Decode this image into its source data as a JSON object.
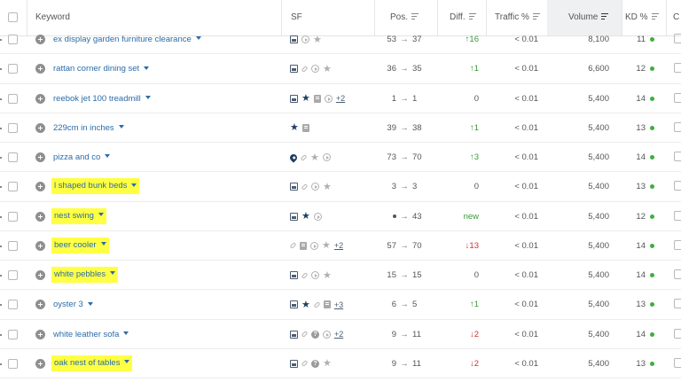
{
  "header": {
    "keyword": "Keyword",
    "sf": "SF",
    "pos": "Pos.",
    "diff": "Diff.",
    "traffic": "Traffic %",
    "volume": "Volume",
    "kd": "KD %",
    "next": "C"
  },
  "colors": {
    "highlight": "#ffff44",
    "link": "#2b6ca8",
    "up": "#3a9a3a",
    "down": "#d0312d",
    "kd_dot": "#3fae3f"
  },
  "rows": [
    {
      "keyword": "ex display garden furniture clearance",
      "highlight": false,
      "sf": [
        "serp-feature-icon",
        "video-icon",
        "star-icon"
      ],
      "more": "",
      "pos_from": "53",
      "pos_to": "37",
      "diff_dir": "up",
      "diff": "16",
      "traffic": "< 0.01",
      "volume": "8,100",
      "kd": "11"
    },
    {
      "keyword": "rattan corner dining set",
      "highlight": false,
      "sf": [
        "serp-feature-icon",
        "link-icon",
        "video-icon",
        "star-icon"
      ],
      "more": "",
      "pos_from": "36",
      "pos_to": "35",
      "diff_dir": "up",
      "diff": "1",
      "traffic": "< 0.01",
      "volume": "6,600",
      "kd": "12"
    },
    {
      "keyword": "reebok jet 100 treadmill",
      "highlight": false,
      "sf": [
        "serp-feature-icon",
        "star-filled-icon",
        "review-icon",
        "video-icon"
      ],
      "more": "+2",
      "pos_from": "1",
      "pos_to": "1",
      "diff_dir": "zero",
      "diff": "0",
      "traffic": "< 0.01",
      "volume": "5,400",
      "kd": "14"
    },
    {
      "keyword": "229cm in inches",
      "highlight": false,
      "sf": [
        "star-filled-icon",
        "review-icon"
      ],
      "more": "",
      "pos_from": "39",
      "pos_to": "38",
      "diff_dir": "up",
      "diff": "1",
      "traffic": "< 0.01",
      "volume": "5,400",
      "kd": "13"
    },
    {
      "keyword": "pizza and co",
      "highlight": false,
      "sf": [
        "map-pin-icon",
        "link-icon",
        "star-icon",
        "video-icon"
      ],
      "more": "",
      "pos_from": "73",
      "pos_to": "70",
      "diff_dir": "up",
      "diff": "3",
      "traffic": "< 0.01",
      "volume": "5,400",
      "kd": "14"
    },
    {
      "keyword": "l shaped bunk beds",
      "highlight": true,
      "sf": [
        "serp-feature-icon",
        "link-icon",
        "video-icon",
        "star-icon"
      ],
      "more": "",
      "pos_from": "3",
      "pos_to": "3",
      "diff_dir": "zero",
      "diff": "0",
      "traffic": "< 0.01",
      "volume": "5,400",
      "kd": "13"
    },
    {
      "keyword": "nest swing",
      "highlight": true,
      "sf": [
        "serp-feature-icon",
        "star-filled-icon",
        "video-icon"
      ],
      "more": "",
      "pos_from": "•",
      "pos_to": "43",
      "diff_dir": "new",
      "diff": "new",
      "traffic": "< 0.01",
      "volume": "5,400",
      "kd": "12"
    },
    {
      "keyword": "beer cooler",
      "highlight": true,
      "sf": [
        "link-icon",
        "review-icon",
        "video-icon",
        "star-icon"
      ],
      "more": "+2",
      "pos_from": "57",
      "pos_to": "70",
      "diff_dir": "down",
      "diff": "13",
      "traffic": "< 0.01",
      "volume": "5,400",
      "kd": "14"
    },
    {
      "keyword": "white pebbles",
      "highlight": true,
      "sf": [
        "serp-feature-icon",
        "link-icon",
        "video-icon",
        "star-icon"
      ],
      "more": "",
      "pos_from": "15",
      "pos_to": "15",
      "diff_dir": "zero",
      "diff": "0",
      "traffic": "< 0.01",
      "volume": "5,400",
      "kd": "14"
    },
    {
      "keyword": "oyster 3",
      "highlight": false,
      "sf": [
        "serp-feature-icon",
        "star-filled-icon",
        "link-icon",
        "review-icon"
      ],
      "more": "+3",
      "pos_from": "6",
      "pos_to": "5",
      "diff_dir": "up",
      "diff": "1",
      "traffic": "< 0.01",
      "volume": "5,400",
      "kd": "13"
    },
    {
      "keyword": "white leather sofa",
      "highlight": false,
      "sf": [
        "serp-feature-icon",
        "link-icon",
        "question-icon",
        "video-icon"
      ],
      "more": "+2",
      "pos_from": "9",
      "pos_to": "11",
      "diff_dir": "down",
      "diff": "2",
      "traffic": "< 0.01",
      "volume": "5,400",
      "kd": "14"
    },
    {
      "keyword": "oak nest of tables",
      "highlight": true,
      "sf": [
        "serp-feature-icon",
        "link-icon",
        "question-icon",
        "star-icon"
      ],
      "more": "",
      "pos_from": "9",
      "pos_to": "11",
      "diff_dir": "down",
      "diff": "2",
      "traffic": "< 0.01",
      "volume": "5,400",
      "kd": "13"
    }
  ]
}
